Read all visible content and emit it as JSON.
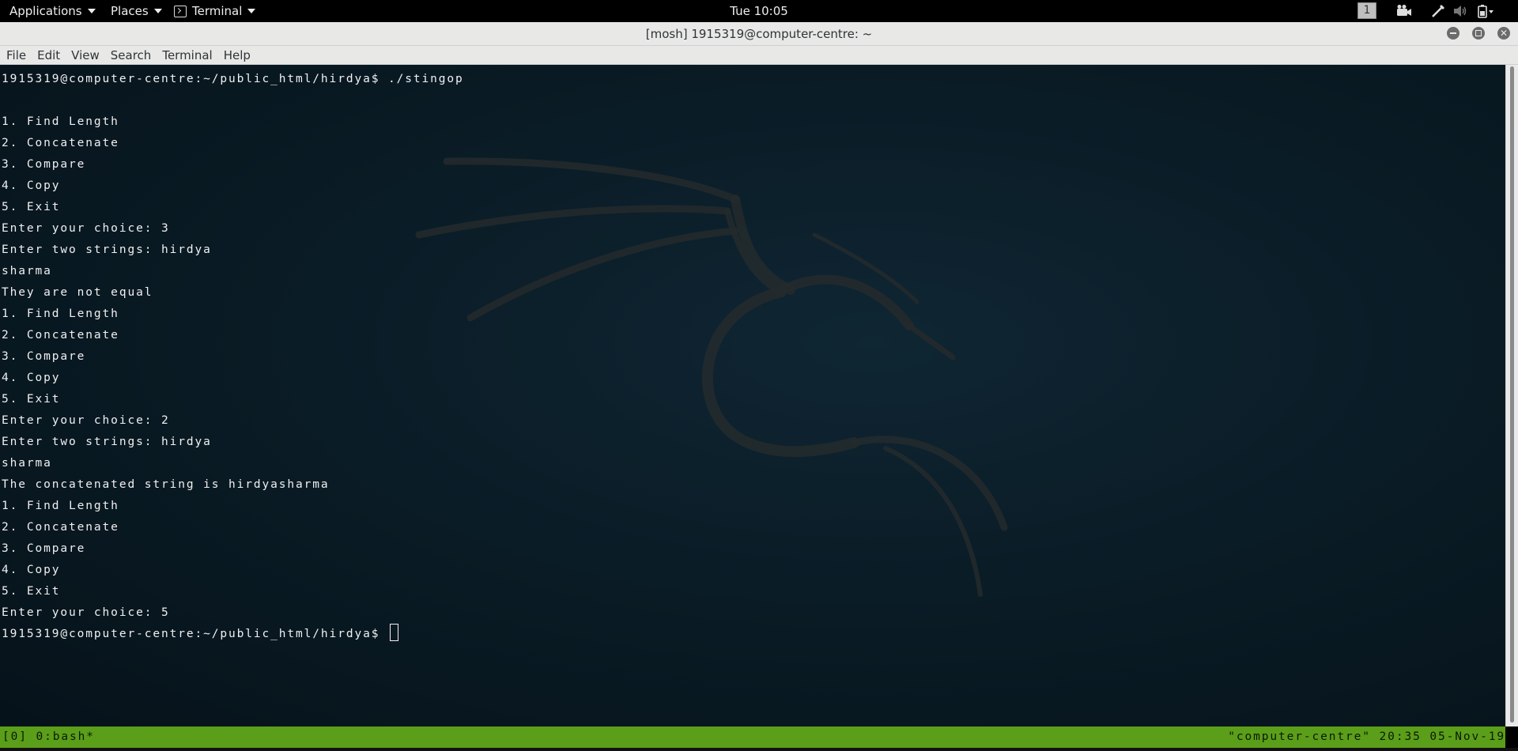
{
  "top_panel": {
    "applications_label": "Applications",
    "places_label": "Places",
    "terminal_label": "Terminal",
    "clock": "Tue 10:05",
    "workspace": "1",
    "tray_icons": [
      "camera-icon",
      "pen-icon",
      "volume-icon",
      "power-icon"
    ]
  },
  "window": {
    "title": "[mosh] 1915319@computer-centre: ~",
    "buttons": [
      "minimize",
      "maximize",
      "close"
    ]
  },
  "menu_bar": {
    "items": [
      "File",
      "Edit",
      "View",
      "Search",
      "Terminal",
      "Help"
    ]
  },
  "terminal": {
    "lines": [
      "1915319@computer-centre:~/public_html/hirdya$ ./stingop",
      "",
      "1. Find Length",
      "2. Concatenate",
      "3. Compare",
      "4. Copy",
      "5. Exit",
      "Enter your choice: 3",
      "Enter two strings: hirdya",
      "sharma",
      "They are not equal",
      "1. Find Length",
      "2. Concatenate",
      "3. Compare",
      "4. Copy",
      "5. Exit",
      "Enter your choice: 2",
      "Enter two strings: hirdya",
      "sharma",
      "The concatenated string is hirdyasharma",
      "1. Find Length",
      "2. Concatenate",
      "3. Compare",
      "4. Copy",
      "5. Exit",
      "Enter your choice: 5"
    ],
    "prompt": "1915319@computer-centre:~/public_html/hirdya$ ",
    "foreground": "#f0f0f0",
    "background": "#0a1c26"
  },
  "tmux_status": {
    "left": "[0] 0:bash*",
    "right": "\"computer-centre\" 20:35 05-Nov-19",
    "color": "#5b9e19"
  }
}
